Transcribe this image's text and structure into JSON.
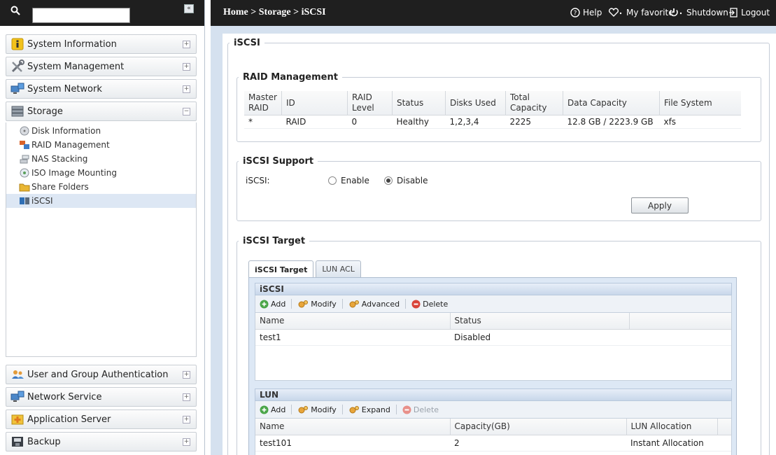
{
  "sidebar": {
    "search": {
      "value": "",
      "placeholder": ""
    },
    "collapse_label": "«",
    "sections": [
      {
        "label": "System Information",
        "icon": "info-icon"
      },
      {
        "label": "System Management",
        "icon": "tools-icon"
      },
      {
        "label": "System Network",
        "icon": "network-icon"
      },
      {
        "label": "Storage",
        "icon": "storage-icon"
      },
      {
        "label": "User and Group Authentication",
        "icon": "users-icon"
      },
      {
        "label": "Network Service",
        "icon": "network-service-icon"
      },
      {
        "label": "Application Server",
        "icon": "application-icon"
      },
      {
        "label": "Backup",
        "icon": "backup-icon"
      }
    ],
    "storage_items": [
      {
        "label": "Disk Information"
      },
      {
        "label": "RAID Management"
      },
      {
        "label": "NAS Stacking"
      },
      {
        "label": "ISO Image Mounting"
      },
      {
        "label": "Share Folders"
      },
      {
        "label": "iSCSI"
      }
    ],
    "expand_glyph": "+",
    "collapse_glyph": "−"
  },
  "header": {
    "breadcrumb": "Home > Storage > iSCSI",
    "help": "Help",
    "favorite": "My favorite",
    "shutdown": "Shutdown",
    "logout": "Logout"
  },
  "page": {
    "title": "iSCSI",
    "raid": {
      "title": "RAID Management",
      "headers": [
        "Master RAID",
        "ID",
        "RAID Level",
        "Status",
        "Disks Used",
        "Total Capacity",
        "Data Capacity",
        "File System"
      ],
      "rows": [
        [
          "*",
          "RAID",
          "0",
          "Healthy",
          "1,2,3,4",
          "2225",
          "12.8 GB / 2223.9 GB",
          "xfs"
        ]
      ]
    },
    "support": {
      "title": "iSCSI Support",
      "label": "iSCSI:",
      "enable": "Enable",
      "disable": "Disable",
      "selected": "Disable",
      "apply": "Apply"
    },
    "target": {
      "title": "iSCSI Target",
      "tabs": [
        "iSCSI Target",
        "LUN ACL"
      ],
      "active_tab": "iSCSI Target",
      "iscsi": {
        "title": "iSCSI",
        "toolbar": [
          "Add",
          "Modify",
          "Advanced",
          "Delete"
        ],
        "headers": [
          "Name",
          "Status"
        ],
        "rows": [
          [
            "test1",
            "Disabled"
          ]
        ]
      },
      "lun": {
        "title": "LUN",
        "toolbar": [
          "Add",
          "Modify",
          "Expand",
          "Delete"
        ],
        "disabled_button": "Delete",
        "headers": [
          "Name",
          "Capacity(GB)",
          "LUN Allocation"
        ],
        "rows": [
          [
            "test101",
            "2",
            "Instant Allocation"
          ]
        ]
      }
    }
  },
  "colors": {
    "topbar": "#1f1f1f",
    "main_bg": "#d5e1ef",
    "active_item": "#dde7f4",
    "panel_bg": "#dde8f5"
  }
}
